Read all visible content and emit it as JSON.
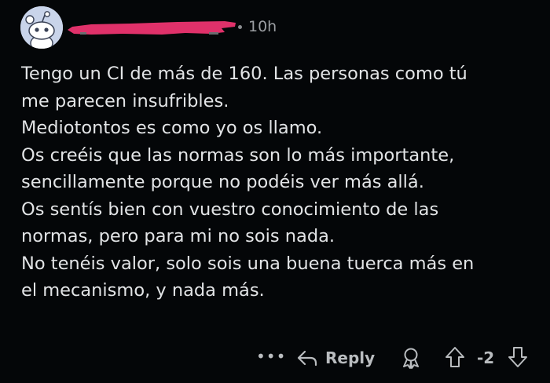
{
  "comment": {
    "timestamp": "10h",
    "lines": [
      "Tengo un CI de más de 160. Las personas como tú",
      "me parecen insufribles.",
      "Mediotontos es como yo os llamo.",
      "Os creéis que las normas son lo más importante,",
      "sencillamente porque no podéis ver más allá.",
      "Os sentís bien con vuestro conocimiento de las",
      "normas, pero para mi no sois nada.",
      "No tenéis valor, solo sois una buena tuerca más en",
      "el mecanismo, y nada más."
    ]
  },
  "actions": {
    "more_label": "•••",
    "reply_label": "Reply",
    "score": "-2"
  },
  "icons": {
    "avatar": "reddit-snoo-avatar",
    "reply": "reply-arrow-icon",
    "award": "award-icon",
    "upvote": "upvote-arrow-icon",
    "downvote": "downvote-arrow-icon"
  },
  "colors": {
    "background": "#040608",
    "text": "#e2e4e6",
    "muted": "#9b9ea2",
    "redaction": "#e0316a",
    "avatar": "#c9d4ea"
  }
}
